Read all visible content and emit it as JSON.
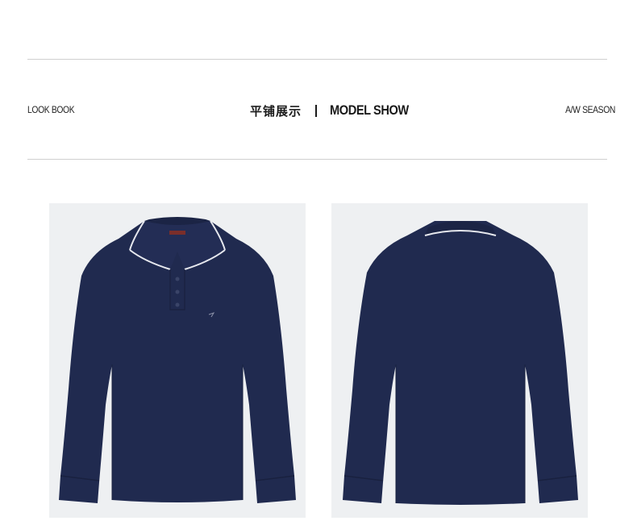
{
  "header": {
    "left_label": "LOOK BOOK",
    "title_cn": "平铺展示",
    "title_en": "MODEL SHOW",
    "right_label": "A/W SEASON"
  },
  "colors": {
    "garment": "#202a4f",
    "garment_shadow": "#19213f",
    "tipping": "#e6e8ee",
    "photo_background": "#eef0f2"
  },
  "photos": [
    {
      "view": "front"
    },
    {
      "view": "back"
    }
  ]
}
